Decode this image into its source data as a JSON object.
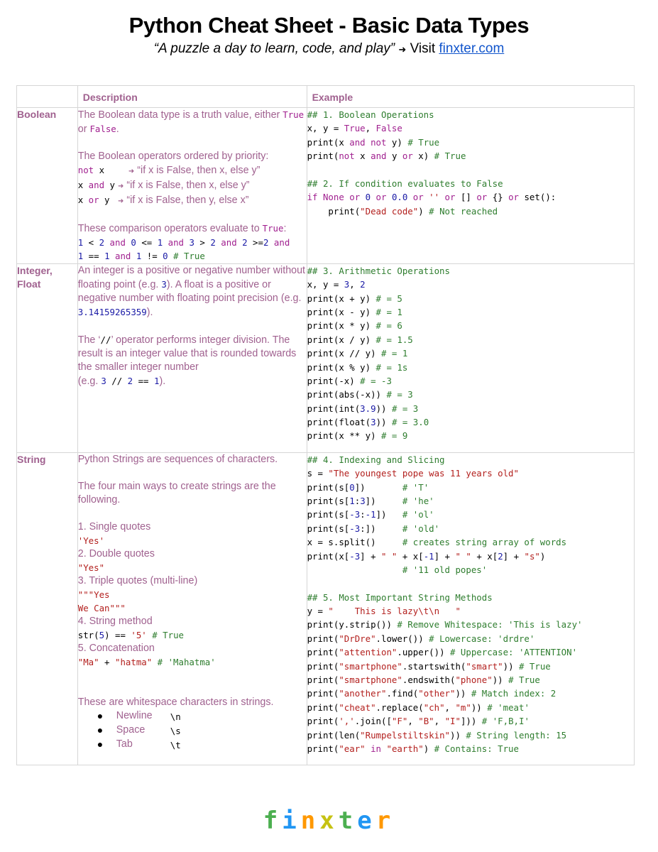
{
  "header": {
    "title": "Python Cheat Sheet - Basic Data Types",
    "quote": "“A puzzle a day to learn, code, and play”",
    "arrow": "➜",
    "visit": "Visit",
    "link": "finxter.com"
  },
  "table": {
    "columns": [
      "",
      "Description",
      "Example"
    ],
    "rows": {
      "boolean": {
        "label": "Boolean",
        "desc": {
          "p1_a": "The Boolean data type is a truth value, either",
          "p1_true": "True",
          "p1_or": " or ",
          "p1_false": "False",
          "p1_end": ".",
          "p2": "The Boolean operators ordered by priority:",
          "ops": [
            {
              "code_a": "not",
              "code_b": " x    ",
              "text": "“if x is False, then x, else y”"
            },
            {
              "code_a": "x ",
              "code_b": "and",
              "code_c": " y",
              "text": "“if x is False, then x, else y”"
            },
            {
              "code_a": "x ",
              "code_b": "or",
              "code_c": " y ",
              "text": "“if x is False, then y, else x”"
            }
          ],
          "p3_a": "These comparison operators evaluate to ",
          "p3_true": "True",
          "p3_end": ":"
        },
        "example": {
          "l1": "## 1. Boolean Operations",
          "l9": "## 2. If condition evaluates to False"
        }
      },
      "integer": {
        "label_1": "Integer,",
        "label_2": "Float",
        "desc": {
          "p1_a": "An integer is a positive or negative number without floating point (e.g. ",
          "p1_num": "3",
          "p1_b": "). A float is a positive or negative number with floating point precision (e.g. ",
          "p1_float": "3.14159265359",
          "p1_end": ").",
          "p2_a": "The ‘",
          "p2_op": "//",
          "p2_b": "’ operator performs integer division. The result is an integer value that is rounded towards the smaller integer number",
          "p2_eg": "(e.g. ",
          "p2_end": ")."
        },
        "example": {
          "l1": "## 3. Arithmetic Operations"
        }
      },
      "string": {
        "label": "String",
        "desc": {
          "p1": "Python Strings are sequences of characters.",
          "p2": "The four main ways to create strings are the following.",
          "m1": "1. Single quotes",
          "m1_code": "'Yes'",
          "m2": "2. Double quotes",
          "m2_code": "\"Yes\"",
          "m3": "3. Triple quotes (multi-line)",
          "m3_code_1": "\"\"\"Yes",
          "m3_code_2": "We Can\"\"\"",
          "m4": "4. String method",
          "m5": "5. Concatenation",
          "ws_intro": "These are whitespace characters in strings.",
          "ws": [
            {
              "bullet": "●",
              "label": "Newline",
              "esc": "\\n"
            },
            {
              "bullet": "●",
              "label": "Space",
              "esc": "\\s"
            },
            {
              "bullet": "●",
              "label": "Tab",
              "esc": "\\t"
            }
          ]
        },
        "example": {
          "l1": "## 4. Indexing and Slicing",
          "l11": "## 5. Most Important String Methods"
        }
      }
    }
  },
  "code_lines": {
    "bool": [
      [
        [
          "c",
          "## 1. Boolean Operations"
        ]
      ],
      [
        [
          "p",
          "x, y = "
        ],
        [
          "k",
          "True"
        ],
        [
          "p",
          ", "
        ],
        [
          "k",
          "False"
        ]
      ],
      [
        [
          "p",
          "print(x "
        ],
        [
          "k",
          "and not"
        ],
        [
          "p",
          " y) "
        ],
        [
          "c",
          "# True"
        ]
      ],
      [
        [
          "p",
          "print("
        ],
        [
          "k",
          "not"
        ],
        [
          "p",
          " x "
        ],
        [
          "k",
          "and"
        ],
        [
          "p",
          " y "
        ],
        [
          "k",
          "or"
        ],
        [
          "p",
          " x) "
        ],
        [
          "c",
          "# True"
        ]
      ],
      [],
      [
        [
          "c",
          "## 2. If condition evaluates to False"
        ]
      ],
      [
        [
          "k",
          "if None or "
        ],
        [
          "n",
          "0"
        ],
        [
          "k",
          " or "
        ],
        [
          "n",
          "0.0"
        ],
        [
          "k",
          " or "
        ],
        [
          "s",
          "''"
        ],
        [
          "k",
          " or "
        ],
        [
          "p",
          "[] "
        ],
        [
          "k",
          "or"
        ],
        [
          "p",
          " {} "
        ],
        [
          "k",
          "or"
        ],
        [
          "p",
          " set():"
        ]
      ],
      [
        [
          "p",
          "    print("
        ],
        [
          "s",
          "\"Dead code\""
        ],
        [
          "p",
          ") "
        ],
        [
          "c",
          "# Not reached"
        ]
      ]
    ],
    "bool_desc": [
      [
        [
          "n",
          "1"
        ],
        [
          "p",
          " < "
        ],
        [
          "n",
          "2"
        ],
        [
          "k",
          " and "
        ],
        [
          "n",
          "0"
        ],
        [
          "p",
          " <= "
        ],
        [
          "n",
          "1"
        ],
        [
          "k",
          " and "
        ],
        [
          "n",
          "3"
        ],
        [
          "p",
          " > "
        ],
        [
          "n",
          "2"
        ],
        [
          "k",
          " and "
        ],
        [
          "n",
          "2"
        ],
        [
          "p",
          " >="
        ],
        [
          "n",
          "2"
        ],
        [
          "k",
          " and"
        ]
      ],
      [
        [
          "n",
          "1"
        ],
        [
          "p",
          " == "
        ],
        [
          "n",
          "1"
        ],
        [
          "k",
          " and "
        ],
        [
          "n",
          "1"
        ],
        [
          "p",
          " != "
        ],
        [
          "n",
          "0"
        ],
        [
          "c",
          " # True"
        ]
      ]
    ],
    "int": [
      [
        [
          "c",
          "## 3. Arithmetic Operations"
        ]
      ],
      [
        [
          "p",
          "x, y = "
        ],
        [
          "n",
          "3"
        ],
        [
          "p",
          ", "
        ],
        [
          "n",
          "2"
        ]
      ],
      [
        [
          "p",
          "print(x + y) "
        ],
        [
          "c",
          "# = 5"
        ]
      ],
      [
        [
          "p",
          "print(x - y) "
        ],
        [
          "c",
          "# = 1"
        ]
      ],
      [
        [
          "p",
          "print(x * y) "
        ],
        [
          "c",
          "# = 6"
        ]
      ],
      [
        [
          "p",
          "print(x / y) "
        ],
        [
          "c",
          "# = 1.5"
        ]
      ],
      [
        [
          "p",
          "print(x // y) "
        ],
        [
          "c",
          "# = 1"
        ]
      ],
      [
        [
          "p",
          "print(x % y) "
        ],
        [
          "c",
          "# = 1s"
        ]
      ],
      [
        [
          "p",
          "print(-x) "
        ],
        [
          "c",
          "# = -3"
        ]
      ],
      [
        [
          "p",
          "print(abs(-x)) "
        ],
        [
          "c",
          "# = 3"
        ]
      ],
      [
        [
          "p",
          "print(int("
        ],
        [
          "n",
          "3.9"
        ],
        [
          "p",
          ")) "
        ],
        [
          "c",
          "# = 3"
        ]
      ],
      [
        [
          "p",
          "print(float("
        ],
        [
          "n",
          "3"
        ],
        [
          "p",
          ")) "
        ],
        [
          "c",
          "# = 3.0"
        ]
      ],
      [
        [
          "p",
          "print(x ** y) "
        ],
        [
          "c",
          "# = 9"
        ]
      ]
    ],
    "int_desc_eg": [
      [
        "n",
        "3"
      ],
      [
        "p",
        " // "
      ],
      [
        "n",
        "2"
      ],
      [
        "p",
        " == "
      ],
      [
        "n",
        "1"
      ]
    ],
    "str_desc_m4": [
      [
        "p",
        "str("
      ],
      [
        "n",
        "5"
      ],
      [
        "p",
        ") == "
      ],
      [
        "s",
        "'5'"
      ],
      [
        "c",
        " # True"
      ]
    ],
    "str_desc_m5": [
      [
        "s",
        "\"Ma\""
      ],
      [
        "p",
        " + "
      ],
      [
        "s",
        "\"hatma\""
      ],
      [
        "c",
        " # 'Mahatma'"
      ]
    ],
    "str": [
      [
        [
          "c",
          "## 4. Indexing and Slicing"
        ]
      ],
      [
        [
          "p",
          "s = "
        ],
        [
          "s",
          "\"The youngest pope was 11 years old\""
        ]
      ],
      [
        [
          "p",
          "print(s["
        ],
        [
          "n",
          "0"
        ],
        [
          "p",
          "])       "
        ],
        [
          "c",
          "# 'T'"
        ]
      ],
      [
        [
          "p",
          "print(s["
        ],
        [
          "n",
          "1"
        ],
        [
          "p",
          ":"
        ],
        [
          "n",
          "3"
        ],
        [
          "p",
          "])     "
        ],
        [
          "c",
          "# 'he'"
        ]
      ],
      [
        [
          "p",
          "print(s["
        ],
        [
          "n",
          "-3"
        ],
        [
          "p",
          ":"
        ],
        [
          "n",
          "-1"
        ],
        [
          "p",
          "])   "
        ],
        [
          "c",
          "# 'ol'"
        ]
      ],
      [
        [
          "p",
          "print(s["
        ],
        [
          "n",
          "-3"
        ],
        [
          "p",
          ":])     "
        ],
        [
          "c",
          "# 'old'"
        ]
      ],
      [
        [
          "p",
          "x = s.split()     "
        ],
        [
          "c",
          "# creates string array of words"
        ]
      ],
      [
        [
          "p",
          "print(x["
        ],
        [
          "n",
          "-3"
        ],
        [
          "p",
          "] + "
        ],
        [
          "s",
          "\" \""
        ],
        [
          "p",
          " + x["
        ],
        [
          "n",
          "-1"
        ],
        [
          "p",
          "] + "
        ],
        [
          "s",
          "\" \""
        ],
        [
          "p",
          " + x["
        ],
        [
          "n",
          "2"
        ],
        [
          "p",
          "] + "
        ],
        [
          "s",
          "\"s\""
        ],
        [
          "p",
          ")"
        ]
      ],
      [
        [
          "p",
          "                  "
        ],
        [
          "c",
          "# '11 old popes'"
        ]
      ],
      [],
      [
        [
          "c",
          "## 5. Most Important String Methods"
        ]
      ],
      [
        [
          "p",
          "y = "
        ],
        [
          "s",
          "\"    This is lazy\\t\\n   \""
        ]
      ],
      [
        [
          "p",
          "print(y.strip()) "
        ],
        [
          "c",
          "# Remove Whitespace: 'This is lazy'"
        ]
      ],
      [
        [
          "p",
          "print("
        ],
        [
          "s",
          "\"DrDre\""
        ],
        [
          "p",
          ".lower()) "
        ],
        [
          "c",
          "# Lowercase: 'drdre'"
        ]
      ],
      [
        [
          "p",
          "print("
        ],
        [
          "s",
          "\"attention\""
        ],
        [
          "p",
          ".upper()) "
        ],
        [
          "c",
          "# Uppercase: 'ATTENTION'"
        ]
      ],
      [
        [
          "p",
          "print("
        ],
        [
          "s",
          "\"smartphone\""
        ],
        [
          "p",
          ".startswith("
        ],
        [
          "s",
          "\"smart\""
        ],
        [
          "p",
          ")) "
        ],
        [
          "c",
          "# True"
        ]
      ],
      [
        [
          "p",
          "print("
        ],
        [
          "s",
          "\"smartphone\""
        ],
        [
          "p",
          ".endswith("
        ],
        [
          "s",
          "\"phone\""
        ],
        [
          "p",
          ")) "
        ],
        [
          "c",
          "# True"
        ]
      ],
      [
        [
          "p",
          "print("
        ],
        [
          "s",
          "\"another\""
        ],
        [
          "p",
          ".find("
        ],
        [
          "s",
          "\"other\""
        ],
        [
          "p",
          ")) "
        ],
        [
          "c",
          "# Match index: 2"
        ]
      ],
      [
        [
          "p",
          "print("
        ],
        [
          "s",
          "\"cheat\""
        ],
        [
          "p",
          ".replace("
        ],
        [
          "s",
          "\"ch\""
        ],
        [
          "p",
          ", "
        ],
        [
          "s",
          "\"m\""
        ],
        [
          "p",
          ")) "
        ],
        [
          "c",
          "# 'meat'"
        ]
      ],
      [
        [
          "p",
          "print("
        ],
        [
          "s",
          "','"
        ],
        [
          "p",
          ".join(["
        ],
        [
          "s",
          "\"F\""
        ],
        [
          "p",
          ", "
        ],
        [
          "s",
          "\"B\""
        ],
        [
          "p",
          ", "
        ],
        [
          "s",
          "\"I\""
        ],
        [
          "p",
          "])) "
        ],
        [
          "c",
          "# 'F,B,I'"
        ]
      ],
      [
        [
          "p",
          "print(len("
        ],
        [
          "s",
          "\"Rumpelstiltskin\""
        ],
        [
          "p",
          ")) "
        ],
        [
          "c",
          "# String length: 15"
        ]
      ],
      [
        [
          "p",
          "print("
        ],
        [
          "s",
          "\"ear\""
        ],
        [
          "k",
          " in "
        ],
        [
          "s",
          "\"earth\""
        ],
        [
          "p",
          ") "
        ],
        [
          "c",
          "# Contains: True"
        ]
      ]
    ]
  },
  "footer": {
    "logo_letters": [
      {
        "ch": "f",
        "color": "#4caf50"
      },
      {
        "ch": "i",
        "color": "#2196f3"
      },
      {
        "ch": "n",
        "color": "#ff9800"
      },
      {
        "ch": "x",
        "color": "#c6c213"
      },
      {
        "ch": "t",
        "color": "#4caf50"
      },
      {
        "ch": "e",
        "color": "#2196f3"
      },
      {
        "ch": "r",
        "color": "#ff9800"
      }
    ]
  },
  "colors": {
    "accent": "#a0618f",
    "link": "#1155cc",
    "keyword": "#a01f8f",
    "number": "#1a1aa6",
    "string": "#b3201e",
    "comment": "#2e7d2e",
    "border": "#d6d6d6"
  }
}
